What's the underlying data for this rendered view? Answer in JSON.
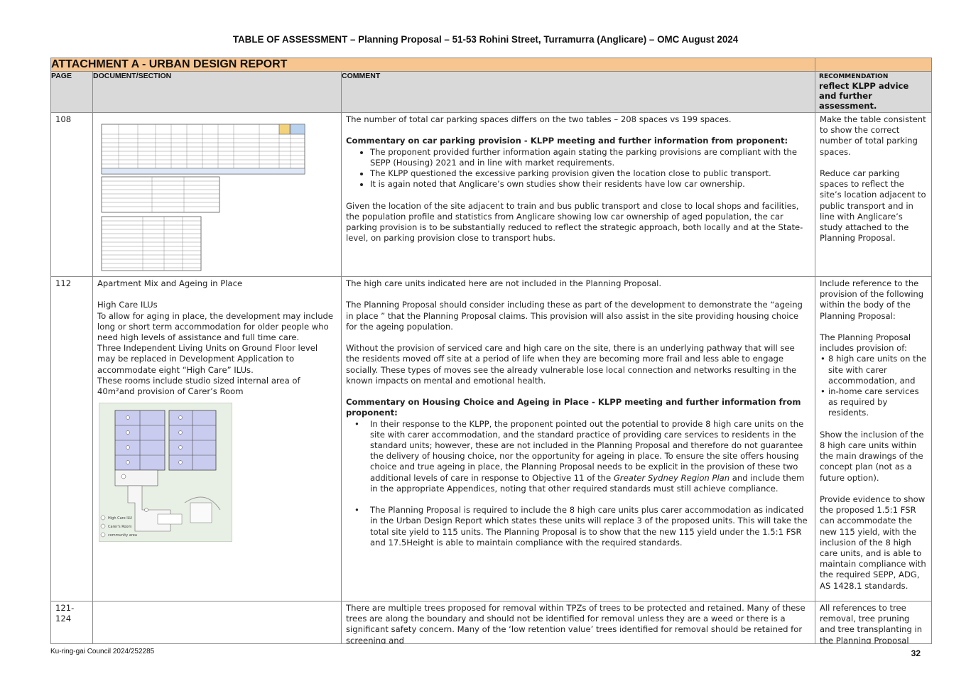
{
  "document": {
    "title": "TABLE OF ASSESSMENT – Planning Proposal – 51-53 Rohini Street, Turramurra (Anglicare) – OMC August 2024",
    "attachment": "ATTACHMENT A - URBAN DESIGN REPORT",
    "footer_left": "Ku-ring-gai Council 2024/252285",
    "page_number": "32"
  },
  "headers": {
    "page": "PAGE",
    "section": "DOCUMENT/SECTION",
    "comment": "COMMENT",
    "rec_small": "RECOMMENDATION",
    "rec_big": "reflect KLPP advice and further assessment."
  },
  "rows": [
    {
      "page": "108",
      "comment": {
        "p1": "The number of total car parking spaces differs on the two tables – 208 spaces vs 199 spaces.",
        "heading": "Commentary on car parking provision - KLPP meeting and further information from proponent:",
        "bullets": [
          "The proponent provided further information again stating the parking provisions are compliant with the SEPP (Housing) 2021 and in line with market requirements.",
          "The KLPP questioned the excessive parking provision given the location close to public transport.",
          "It is again noted that Anglicare’s own studies show their residents have low car ownership."
        ],
        "p2": "Given the location of the site adjacent to train and bus public transport and close to local shops and facilities, the population profile and statistics from Anglicare showing low car ownership of aged population, the car parking provision is to be substantially reduced to reflect the strategic approach, both locally and at the State-level, on parking provision close to transport hubs."
      },
      "rec": {
        "p1": "Make the table consistent to show the correct number of total parking spaces.",
        "p2": "Reduce car parking spaces to reflect the site’s location adjacent to public transport and in line with Anglicare’s study attached to the Planning Proposal."
      }
    },
    {
      "page": "112",
      "section": {
        "title": "Apartment Mix and Ageing in Place",
        "subtitle": "High Care ILUs",
        "p1": "To allow for aging in place, the development may include long or short term accommodation for older people who need high levels of assistance and full time care.",
        "p2": "Three Independent Living Units on Ground Floor level may be replaced in Development Application to accommodate eight “High Care” ILUs.",
        "p3": "These rooms include studio sized internal area of 40m²and provision of Carer’s Room",
        "legend": [
          "High Care ILU",
          "Carer's Room",
          "community area"
        ]
      },
      "comment": {
        "p1": "The high care units indicated here are not included in the Planning Proposal.",
        "p2": "The Planning Proposal should consider including these as part of the development to demonstrate the “ageing in place ” that the Planning Proposal claims. This provision will also assist in the site providing housing choice for the ageing population.",
        "p3": "Without the provision of serviced care and high care on the site, there is an underlying pathway that will see the residents moved off site at a period of life when they are becoming more frail and less able to engage socially. These types of moves see the already vulnerable lose local connection and networks resulting in the known impacts on mental and emotional health.",
        "heading": "Commentary on Housing Choice and Ageing in Place - KLPP meeting and further information from proponent:",
        "b1_pre": "In their response to the KLPP, the proponent pointed out the potential to provide 8 high care units on the site with carer accommodation, and the standard practice of providing care services to residents in the standard units; however, these are not included in the Planning Proposal and therefore do not guarantee the delivery of housing choice, nor the opportunity for ageing in place. To ensure the site offers housing choice and true ageing in place, the Planning Proposal needs to be explicit in the provision of these two additional levels of care in response to Objective 11 of the ",
        "b1_italic": "Greater Sydney Region Plan",
        "b1_post": " and include them in the appropriate Appendices, noting that other required standards must still achieve compliance.",
        "b2": "The Planning Proposal is required to include the 8 high care units plus carer accommodation as indicated in the Urban Design Report which states these units will replace 3 of the proposed units. This will take the total site yield to 115 units. The Planning Proposal is to show that the new 115 yield under the 1.5:1 FSR and 17.5Height is able to maintain compliance with the required standards."
      },
      "rec": {
        "p1": "Include reference to the provision of the following within the body of the Planning Proposal:",
        "p2": "The Planning Proposal includes provision of:",
        "bullets": [
          "8 high care units on the site with carer accommodation, and",
          "in-home care services as required by residents."
        ],
        "p3": "Show the inclusion of the 8 high care units within the main drawings of the concept plan (not as a future option).",
        "p4": "Provide evidence to show the proposed 1.5:1 FSR can accommodate the new 115 yield, with the inclusion of the 8 high care units, and is able to maintain compliance with the required SEPP, ADG, AS 1428.1 standards."
      }
    },
    {
      "page": "121-124",
      "comment": {
        "p1": "There are multiple trees proposed for removal within TPZs of trees to be protected and retained. Many of these trees are along the boundary and should not be identified for removal unless they are a weed or there is a significant safety concern. Many of the ‘low retention value’ trees identified for removal should be retained for screening and"
      },
      "rec": {
        "p1": "All references to tree removal, tree pruning and tree transplanting in the Planning Proposal and its"
      }
    }
  ]
}
